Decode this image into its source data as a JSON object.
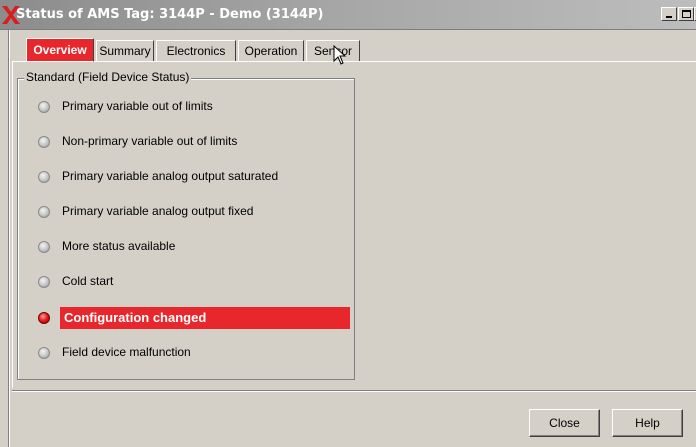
{
  "window": {
    "title": "Status of AMS Tag: 3144P - Demo (3144P)",
    "icons": {
      "app": "x-logo-icon",
      "minimize": "minimize-icon",
      "maximize": "maximize-icon",
      "close": "close-icon"
    }
  },
  "tabs": [
    {
      "label": "Overview",
      "active": true
    },
    {
      "label": "Summary",
      "active": false
    },
    {
      "label": "Electronics",
      "active": false
    },
    {
      "label": "Operation",
      "active": false
    },
    {
      "label": "Sensor",
      "active": false
    }
  ],
  "group": {
    "title": "Standard (Field Device Status)",
    "items": [
      {
        "label": "Primary variable out of limits",
        "active": false
      },
      {
        "label": "Non-primary variable out of limits",
        "active": false
      },
      {
        "label": "Primary variable analog output saturated",
        "active": false
      },
      {
        "label": "Primary variable analog output fixed",
        "active": false
      },
      {
        "label": "More status available",
        "active": false
      },
      {
        "label": "Cold start",
        "active": false
      },
      {
        "label": "Configuration changed",
        "active": true
      },
      {
        "label": "Field device malfunction",
        "active": false
      }
    ]
  },
  "buttons": {
    "close": "Close",
    "help": "Help"
  },
  "colors": {
    "accent": "#e8272c",
    "face": "#d4d0c8"
  }
}
